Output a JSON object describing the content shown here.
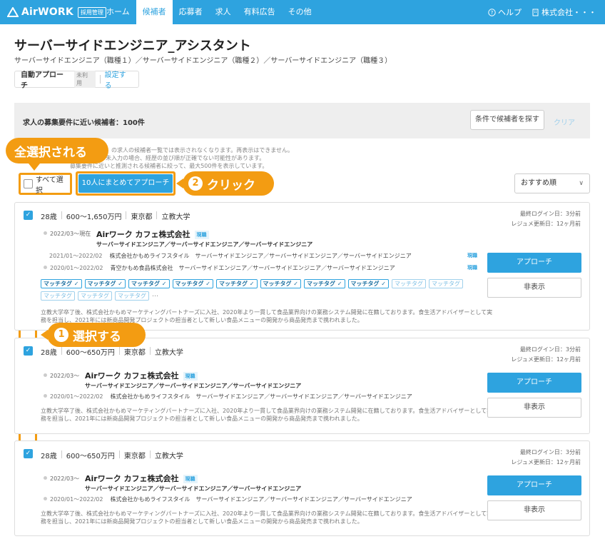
{
  "header": {
    "logo_text": "AirWORK",
    "logo_badge": "採用管理",
    "nav": [
      "ホーム",
      "候補者",
      "応募者",
      "求人",
      "有料広告",
      "その他"
    ],
    "active_nav": "候補者",
    "help": "ヘルプ",
    "company": "株式会社・・・"
  },
  "page": {
    "title": "サーバーサイドエンジニア_アシスタント",
    "subtitle": "サーバーサイドエンジニア（職種１）／サーバーサイドエンジニア（職種２）／サーバーサイドエンジニア（職種３）",
    "auto_label": "自動アプローチ",
    "auto_status": "未利用",
    "auto_link": "設定する"
  },
  "searchbar": {
    "count_text": "求人の募集要件に近い候補者：100件",
    "cond_button": "条件で候補者を探す",
    "clear": "クリア"
  },
  "notes": [
    "の求人の候補者一覧では表示されなくなります。再表示はできません。",
    "が未入力の場合、経歴の並び順が正確でない可能性があります。",
    "募集要件に近いと推測される候補者に絞って、最大500件を表示しています。"
  ],
  "toolbar": {
    "select_all": "すべて選択",
    "bulk_approach": "10人にまとめてアプローチ",
    "sort": "おすすめ順"
  },
  "callouts": {
    "select_all": "全選択される",
    "click_num": "2",
    "click": "クリック",
    "select_num": "1",
    "select": "選択する"
  },
  "candidates": [
    {
      "age": "28歳",
      "salary": "600〜1,650万円",
      "location": "東京都",
      "school": "立教大学",
      "last_login": "最終ログイン日：3分前",
      "resume_updated": "レジュメ更新日：12ヶ月前",
      "current_date": "2022/03〜現在",
      "current_company": "Airワーク カフェ株式会社",
      "now_badge": "現職",
      "current_titles": "サーバーサイドエンジニア／サーバーサイドエンジニア／サーバーサイドエンジニア",
      "history": [
        {
          "date": "2021/01〜2022/02",
          "text": "株式会社かもめライフスタイル　サーバーサイドエンジニア／サーバーサイドエンジニア／サーバーサイドエンジニア",
          "badge": "現職"
        },
        {
          "date": "2020/01〜2022/02",
          "text": "青空かもめ食品株式会社　サーバーサイドエンジニア／サーバーサイドエンジニア／サーバーサイドエンジニア",
          "badge": "現職"
        }
      ],
      "tags_on": [
        "マッチタグ",
        "マッチタグ",
        "マッチタグ",
        "マッチタグ",
        "マッチタグ",
        "マッチタグ",
        "マッチタグ",
        "マッチタグ"
      ],
      "tags_off": [
        "マッチタグ",
        "マッチタグ",
        "マッチタグ",
        "マッチタグ",
        "マッチタグ"
      ],
      "more": "…",
      "desc": "立教大学卒了後、株式会社かもめマーケティングパートナーズに入社、2020年より一貫して食品業界向けの業務システム開発に在籍しております。食生活アドバイザーとして実務を担当し、2021年には新商品開発プロジェクトの担当者として新しい食品メニューの開発から商品発売まで携われました。",
      "approach": "アプローチ",
      "hide": "非表示"
    },
    {
      "age": "28歳",
      "salary": "600〜650万円",
      "location": "東京都",
      "school": "立教大学",
      "last_login": "最終ログイン日：3分前",
      "resume_updated": "レジュメ更新日：12ヶ月前",
      "current_date": "2022/03〜",
      "current_company": "Airワーク カフェ株式会社",
      "now_badge": "現職",
      "current_titles": "サーバーサイドエンジニア／サーバーサイドエンジニア／サーバーサイドエンジニア",
      "history": [
        {
          "date": "2020/01〜2022/02",
          "text": "株式会社かもめライフスタイル　サーバーサイドエンジニア／サーバーサイドエンジニア／サーバーサイドエンジニア"
        }
      ],
      "desc": "立教大学卒了後、株式会社かもめマーケティングパートナーズに入社、2020年より一貫して食品業界向けの業務システム開発に在籍しております。食生活アドバイザーとして実務を担当し、2021年には新商品開発プロジェクトの担当者として新しい食品メニューの開発から商品発売まで携われました。",
      "approach": "アプローチ",
      "hide": "非表示"
    },
    {
      "age": "28歳",
      "salary": "600〜650万円",
      "location": "東京都",
      "school": "立教大学",
      "last_login": "最終ログイン日：3分前",
      "resume_updated": "レジュメ更新日：12ヶ月前",
      "current_date": "2022/03〜",
      "current_company": "Airワーク カフェ株式会社",
      "now_badge": "現職",
      "current_titles": "サーバーサイドエンジニア／サーバーサイドエンジニア／サーバーサイドエンジニア",
      "history": [
        {
          "date": "2020/01〜2022/02",
          "text": "株式会社かもめライフスタイル　サーバーサイドエンジニア／サーバーサイドエンジニア／サーバーサイドエンジニア"
        }
      ],
      "desc": "立教大学卒了後、株式会社かもめマーケティングパートナーズに入社、2020年より一貫して食品業界向けの業務システム開発に在籍しております。食生活アドバイザーとして実務を担当し、2021年には新商品開発プロジェクトの担当者として新しい食品メニューの開発から商品発売まで携われました。",
      "approach": "アプローチ",
      "hide": "非表示"
    }
  ],
  "colors": {
    "accent": "#2ea3df",
    "callout": "#f39c12"
  }
}
